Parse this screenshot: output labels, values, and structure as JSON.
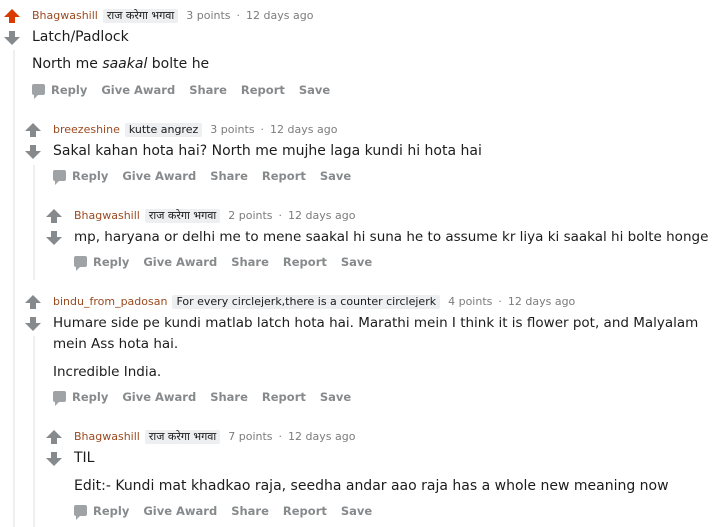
{
  "colors": {
    "upvote_active": "#d93a00",
    "vote_neutral": "#878a8c",
    "author": "#9a4a1f",
    "flair_bg": "#edeff1",
    "meta": "#7c7c7c"
  },
  "icons": {
    "upvote": "arrow-up-icon",
    "downvote": "arrow-down-icon",
    "reply": "speech-bubble-icon"
  },
  "actions": {
    "reply": "Reply",
    "give_award": "Give Award",
    "share": "Share",
    "report": "Report",
    "save": "Save"
  },
  "separator": "·",
  "comments": [
    {
      "author": "Bhagwashill",
      "flair": "राज करेगा भगवा",
      "points": "3 points",
      "time": "12 days ago",
      "upvoted": true,
      "body": [
        "Latch/Padlock",
        "North me ",
        "saakal",
        " bolte he"
      ]
    },
    {
      "author": "breezeshine",
      "flair": "kutte angrez",
      "points": "3 points",
      "time": "12 days ago",
      "upvoted": false,
      "body": [
        "Sakal kahan hota hai? North me mujhe laga kundi hi hota hai"
      ]
    },
    {
      "author": "Bhagwashill",
      "flair": "राज करेगा भगवा",
      "points": "2 points",
      "time": "12 days ago",
      "upvoted": false,
      "body": [
        "mp, haryana or delhi me to mene saakal hi suna he to assume kr liya ki saakal hi bolte honge"
      ]
    },
    {
      "author": "bindu_from_padosan",
      "flair": "For every circlejerk,there is a counter circlejerk",
      "points": "4 points",
      "time": "12 days ago",
      "upvoted": false,
      "body": [
        "Humare side pe kundi matlab latch hota hai. Marathi mein I think it is flower pot, and Malyalam",
        "mein Ass hota hai.",
        "Incredible India."
      ]
    },
    {
      "author": "Bhagwashill",
      "flair": "राज करेगा भगवा",
      "points": "7 points",
      "time": "12 days ago",
      "upvoted": false,
      "body": [
        "TIL",
        "Edit:- Kundi mat khadkao raja, seedha andar aao raja has a whole new meaning now"
      ]
    }
  ]
}
